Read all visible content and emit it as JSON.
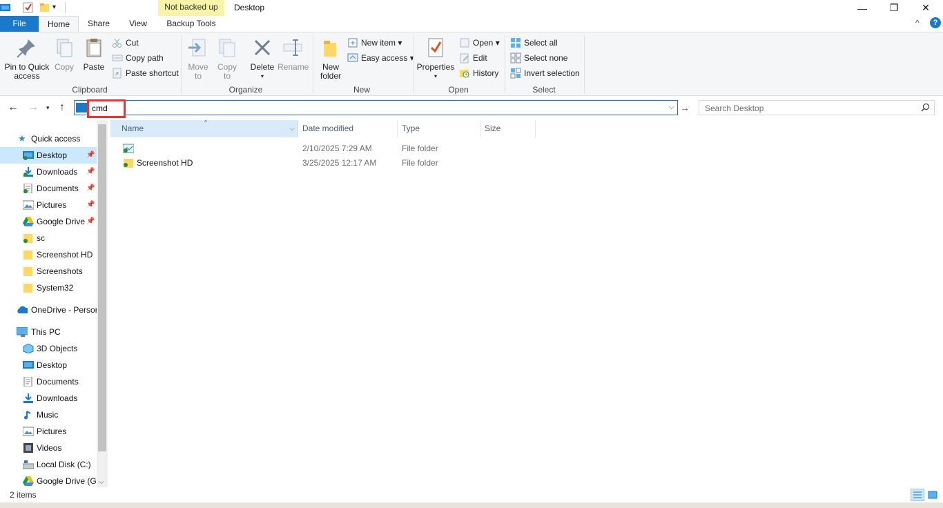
{
  "window": {
    "title": "Desktop",
    "contextual_tab_group": "Not backed up",
    "minimize_glyph": "—",
    "maximize_glyph": "❐",
    "close_glyph": "✕"
  },
  "tabs": {
    "file": "File",
    "home": "Home",
    "share": "Share",
    "view": "View",
    "backup_tools": "Backup Tools"
  },
  "ribbon": {
    "clipboard": {
      "label": "Clipboard",
      "pin_line1": "Pin to Quick",
      "pin_line2": "access",
      "copy": "Copy",
      "paste": "Paste",
      "cut": "Cut",
      "copy_path": "Copy path",
      "paste_shortcut": "Paste shortcut"
    },
    "organize": {
      "label": "Organize",
      "move_line1": "Move",
      "move_line2": "to",
      "copy_line1": "Copy",
      "copy_line2": "to",
      "delete": "Delete",
      "rename": "Rename"
    },
    "new": {
      "label": "New",
      "new_folder_line1": "New",
      "new_folder_line2": "folder",
      "new_item": "New item",
      "easy_access": "Easy access"
    },
    "open": {
      "label": "Open",
      "properties": "Properties",
      "open": "Open",
      "edit": "Edit",
      "history": "History"
    },
    "select": {
      "label": "Select",
      "select_all": "Select all",
      "select_none": "Select none",
      "invert_selection": "Invert selection"
    },
    "help_glyph": "?",
    "collapse_glyph": "^"
  },
  "address": {
    "value": "cmd",
    "search_placeholder": "Search Desktop"
  },
  "nav": {
    "quick_access": "Quick access",
    "items": [
      {
        "label": "Desktop",
        "icon": "desktop-icon",
        "pinned": true
      },
      {
        "label": "Downloads",
        "icon": "downloads-icon",
        "pinned": true
      },
      {
        "label": "Documents",
        "icon": "documents-icon",
        "pinned": true
      },
      {
        "label": "Pictures",
        "icon": "pictures-icon",
        "pinned": true
      },
      {
        "label": "Google Drive",
        "icon": "google-drive-icon",
        "pinned": true
      },
      {
        "label": "sc",
        "icon": "folder-icon",
        "pinned": false
      },
      {
        "label": "Screenshot HD",
        "icon": "folder-icon",
        "pinned": false
      },
      {
        "label": "Screenshots",
        "icon": "folder-icon",
        "pinned": false
      },
      {
        "label": "System32",
        "icon": "folder-icon",
        "pinned": false
      }
    ],
    "onedrive": "OneDrive - Persor",
    "this_pc": "This PC",
    "pc_items": [
      {
        "label": "3D Objects",
        "icon": "3d-objects-icon"
      },
      {
        "label": "Desktop",
        "icon": "desktop-icon"
      },
      {
        "label": "Documents",
        "icon": "documents-icon"
      },
      {
        "label": "Downloads",
        "icon": "downloads-icon"
      },
      {
        "label": "Music",
        "icon": "music-icon"
      },
      {
        "label": "Pictures",
        "icon": "pictures-icon"
      },
      {
        "label": "Videos",
        "icon": "videos-icon"
      },
      {
        "label": "Local Disk (C:)",
        "icon": "local-disk-icon"
      },
      {
        "label": "Google Drive (G:",
        "icon": "google-drive-icon"
      }
    ]
  },
  "filelist": {
    "columns": {
      "name": "Name",
      "date": "Date modified",
      "type": "Type",
      "size": "Size"
    },
    "rows": [
      {
        "name": "",
        "date": "2/10/2025 7:29 AM",
        "type": "File folder",
        "size": ""
      },
      {
        "name": "Screenshot HD",
        "date": "3/25/2025 12:17 AM",
        "type": "File folder",
        "size": ""
      }
    ]
  },
  "status": {
    "count": "2 items"
  },
  "colors": {
    "accent": "#1979ca",
    "selection": "#cce8ff",
    "highlight_box": "#ee3333",
    "backup_band": "#f7f3a8"
  }
}
